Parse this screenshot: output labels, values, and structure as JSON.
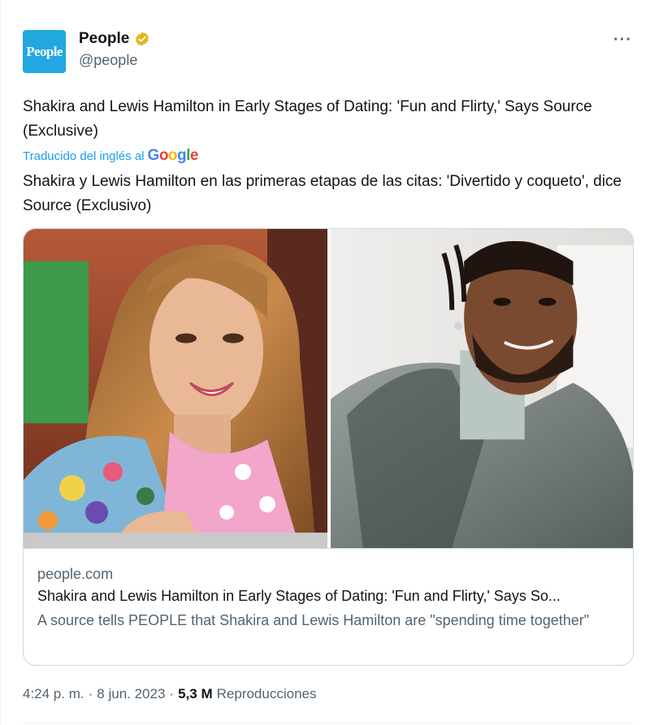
{
  "author": {
    "avatar_text": "People",
    "name": "People",
    "handle": "@people",
    "verified_color": "#e2b719"
  },
  "menu": {
    "more_label": "···"
  },
  "tweet": {
    "text": "Shakira and Lewis Hamilton in Early Stages of Dating: 'Fun and Flirty,' Says Source (Exclusive)",
    "translated_label": "Traducido del inglés al",
    "translator_logo": [
      "G",
      "o",
      "o",
      "g",
      "l",
      "e"
    ],
    "translated_text": "Shakira y Lewis Hamilton en las primeras etapas de las citas: 'Divertido y coqueto', dice Source (Exclusivo)"
  },
  "card": {
    "domain": "people.com",
    "title": "Shakira and Lewis Hamilton in Early Stages of Dating: 'Fun and Flirty,' Says So...",
    "description": "A source tells PEOPLE that Shakira and Lewis Hamilton are \"spending time together\""
  },
  "meta": {
    "time": "4:24 p. m.",
    "separator": "·",
    "date": "8 jun. 2023",
    "views_count": "5,3 M",
    "views_label": "Reproducciones"
  }
}
